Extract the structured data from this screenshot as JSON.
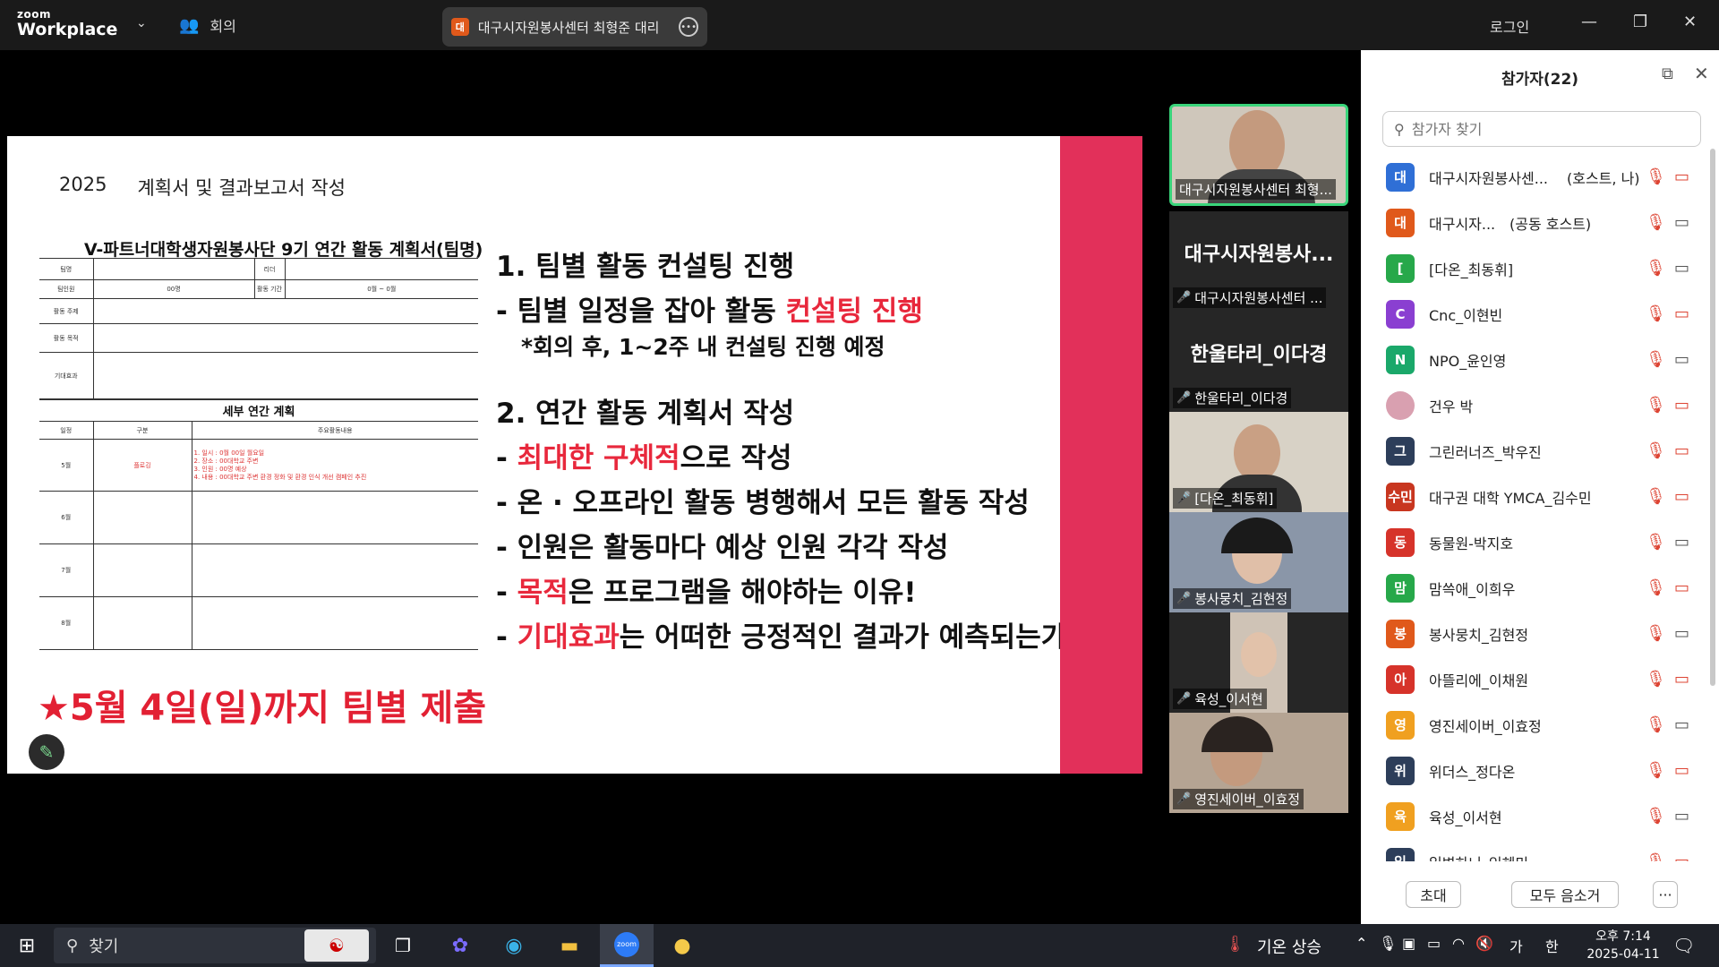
{
  "titlebar": {
    "brand_small": "zoom",
    "brand_large": "Workplace",
    "meetings_label": "회의",
    "meeting_avatar": "대",
    "meeting_name": "대구시자원봉사센터 최형준 대리",
    "login": "로그인"
  },
  "slide": {
    "year": "2025",
    "title": "계획서 및 결과보고서 작성",
    "form_title": "V-파트너대학생자원봉사단 9기 연간 활동 계획서(팀명)",
    "form": {
      "team": "팀명",
      "leader": "리더",
      "members": "팀인원",
      "members_val": "00명",
      "period": "활동 기간",
      "period_val": "0월 ~ 0월",
      "topic": "활동 주제",
      "purpose": "활동 목적",
      "effect": "기대효과",
      "detail_head": "세부 연간 계획",
      "col_date": "일정",
      "col_type": "구분",
      "col_content": "주요활동내용",
      "m5": "5월",
      "m5_type": "플로깅",
      "m5_lines": [
        "1. 일시 : 0월 00일 월요일",
        "2. 장소 : 00대학교 주변",
        "3. 인원 : 00명 예상",
        "4. 내용 : 00대학교 주변 환경 정화 및 환경 인식 개선 캠페인 추진"
      ],
      "m6": "6월",
      "m7": "7월",
      "m8": "8월"
    },
    "deadline": "★5월 4일(일)까지 팀별 제출",
    "p1_title": "1. 팀별 활동 컨설팅 진행",
    "p1_line_a": "- 팀별 일정을 잡아 활동 ",
    "p1_line_a_red": "컨설팅 진행",
    "p1_note": "*회의 후, 1~2주 내 컨설팅 진행 예정",
    "p2_title": "2. 연간 활동 계획서 작성",
    "p2_l1_pre": "- ",
    "p2_l1_red": "최대한 구체적",
    "p2_l1_post": "으로 작성",
    "p2_l2": "- 온 · 오프라인 활동 병행해서 모든 활동 작성",
    "p2_l3": "- 인원은 활동마다 예상 인원 각각 작성",
    "p2_l4_pre": "- ",
    "p2_l4_red": "목적",
    "p2_l4_post": "은 프로그램을 해야하는 이유!",
    "p2_l5_pre": "- ",
    "p2_l5_red": "기대효과",
    "p2_l5_post": "는 어떠한 긍정적인 결과가 예측되는가?"
  },
  "videos": {
    "v1_name": "대구시자원봉사센터 최형...",
    "v2_big": "대구시자원봉사...",
    "v2_name": "대구시자원봉사센터 ...",
    "v3_big": "한울타리_이다경",
    "v3_name": "한울타리_이다경",
    "v4_name": "[다온_최동휘]",
    "v5_name": "봉사뭉치_김현정",
    "v6_name": "육성_이서현",
    "v7_name": "영진세이버_이효정"
  },
  "panel": {
    "title": "참가자(22)",
    "search_placeholder": "참가자 찾기",
    "participants": [
      {
        "avatar": "대",
        "name": "대구시자원봉사센...",
        "role": "(호스트, 나)",
        "color": "#2f6fd6",
        "cam": "off"
      },
      {
        "avatar": "대",
        "name": "대구시자...",
        "role": "(공동 호스트)",
        "color": "#e0591b",
        "cam": "on"
      },
      {
        "avatar": "[",
        "name": "[다온_최동휘]",
        "role": "",
        "color": "#27a84a",
        "cam": "on"
      },
      {
        "avatar": "C",
        "name": "Cnc_이현빈",
        "role": "",
        "color": "#8a3fd1",
        "cam": "off"
      },
      {
        "avatar": "N",
        "name": "NPO_윤인영",
        "role": "",
        "color": "#1aa86a",
        "cam": "on"
      },
      {
        "avatar": "",
        "name": "건우 박",
        "role": "",
        "color": "#d9a0b0",
        "cam": "off"
      },
      {
        "avatar": "그",
        "name": "그린러너즈_박우진",
        "role": "",
        "color": "#2d3e5a",
        "cam": "off"
      },
      {
        "avatar": "수민",
        "name": "대구권 대학 YMCA_김수민",
        "role": "",
        "color": "#c8361f",
        "cam": "off"
      },
      {
        "avatar": "동",
        "name": "동물원-박지호",
        "role": "",
        "color": "#d6332a",
        "cam": "on"
      },
      {
        "avatar": "맘",
        "name": "맘쓱애_이희우",
        "role": "",
        "color": "#27a84a",
        "cam": "off"
      },
      {
        "avatar": "봉",
        "name": "봉사뭉치_김현정",
        "role": "",
        "color": "#e0591b",
        "cam": "on"
      },
      {
        "avatar": "아",
        "name": "아뜰리에_이채원",
        "role": "",
        "color": "#d6332a",
        "cam": "off"
      },
      {
        "avatar": "영",
        "name": "영진세이버_이효정",
        "role": "",
        "color": "#f0a020",
        "cam": "on"
      },
      {
        "avatar": "위",
        "name": "위더스_정다온",
        "role": "",
        "color": "#2d3e5a",
        "cam": "off"
      },
      {
        "avatar": "육",
        "name": "육성_이서현",
        "role": "",
        "color": "#f0a020",
        "cam": "on"
      },
      {
        "avatar": "일",
        "name": "일병하니_임혜미",
        "role": "",
        "color": "#2d3e5a",
        "cam": "off"
      }
    ],
    "btn_invite": "초대",
    "btn_mute_all": "모두 음소거",
    "btn_more": "···"
  },
  "taskbar": {
    "search_label": "찾기",
    "weather": "기온 상승",
    "ime": "가",
    "ime2": "한",
    "time": "오후 7:14",
    "date": "2025-04-11"
  }
}
